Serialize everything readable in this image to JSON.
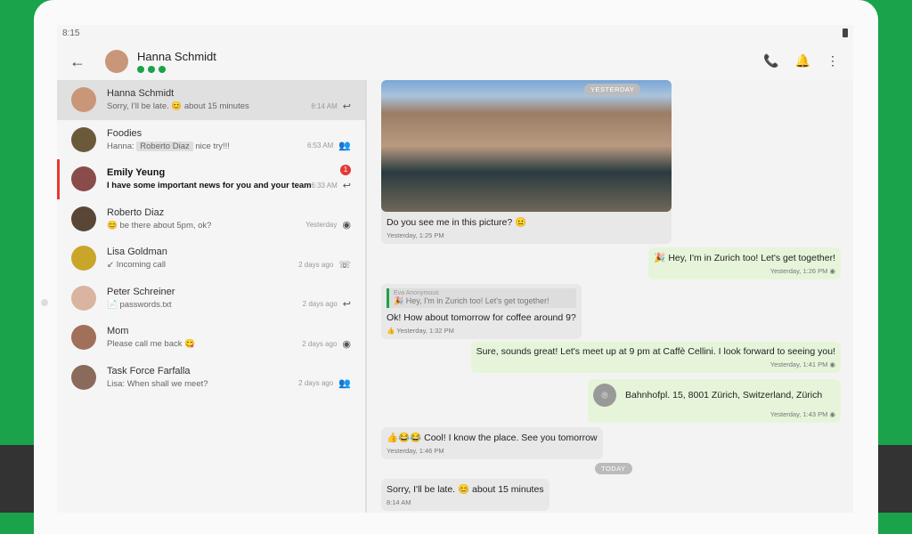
{
  "status": {
    "time": "8:15"
  },
  "header": {
    "name": "Hanna Schmidt"
  },
  "chats": [
    {
      "name": "Hanna Schmidt",
      "preview": "Sorry, I'll be late. 😊 about 15 minutes",
      "time": "8:14 AM",
      "icon": "reply-icon",
      "avatar": "#c9967a"
    },
    {
      "name": "Foodies",
      "prefix": "Hanna: ",
      "mention": "Roberto Diaz",
      "preview": " nice try!!!",
      "time": "6:53 AM",
      "icon": "group-icon",
      "avatar": "#6b5a3a"
    },
    {
      "name": "Emily Yeung",
      "preview": "I have some important news for you and your team",
      "time": "6:33 AM",
      "icon": "reply-icon",
      "avatar": "#8a4b4b",
      "badge": "1"
    },
    {
      "name": "Roberto Diaz",
      "preview": "😊 be there about 5pm, ok?",
      "time": "Yesterday",
      "icon": "eye-icon",
      "avatar": "#5a4636"
    },
    {
      "name": "Lisa Goldman",
      "preview": "↙ Incoming call",
      "time": "2 days ago",
      "icon": "phone-icon",
      "avatar": "#c9a62a"
    },
    {
      "name": "Peter Schreiner",
      "preview": "📄 passwords.txt",
      "time": "2 days ago",
      "icon": "reply-icon",
      "avatar": "#d9b4a0"
    },
    {
      "name": "Mom",
      "preview": "Please call me back 😋",
      "time": "2 days ago",
      "icon": "eye-icon",
      "avatar": "#a0705a"
    },
    {
      "name": "Task Force Farfalla",
      "preview": "Lisa: When shall we meet?",
      "time": "2 days ago",
      "icon": "group-icon",
      "avatar": "#8a6a5a"
    }
  ],
  "messages": {
    "yesterday": "YESTERDAY",
    "today": "TODAY",
    "m1": {
      "text": "Do you see me in this picture? 😐",
      "time": "Yesterday, 1:25 PM"
    },
    "m2": {
      "text": "🎉 Hey, I'm in Zurich too!  Let's get together!",
      "time": "Yesterday, 1:26 PM ◉"
    },
    "m3": {
      "quote_author": "Eva Anonymous",
      "quote": "🎉 Hey, I'm in Zurich too!  Let's get together!",
      "text": "Ok! How about tomorrow for coffee around 9?",
      "time": "👍 Yesterday, 1:32 PM"
    },
    "m4": {
      "text": "Sure, sounds great! Let's meet up at 9 pm at Caffè Cellini. I look forward to seeing you!",
      "time": "Yesterday, 1:41 PM ◉"
    },
    "m5": {
      "text": "Bahnhofpl. 15, 8001 Zürich, Switzerland, Zürich",
      "time": "Yesterday, 1:43 PM ◉"
    },
    "m6": {
      "text": "👍😂😂 Cool! I know the place. See you tomorrow",
      "time": "Yesterday, 1:46 PM"
    },
    "m7": {
      "text": "Sorry, I'll be late. 😊 about 15 minutes",
      "time": "8:14 AM"
    }
  }
}
